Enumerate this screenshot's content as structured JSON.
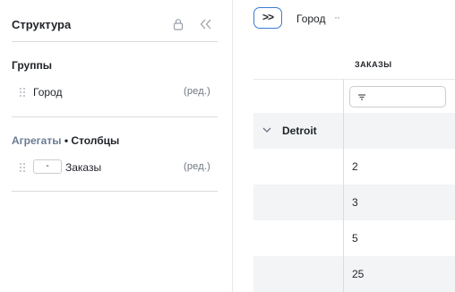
{
  "sidebar": {
    "title": "Структура",
    "groups_section": {
      "title": "Группы",
      "items": [
        {
          "label": "Город",
          "edit_label": "(ред.)"
        }
      ]
    },
    "aggregates_section": {
      "title_part1": "Агрегаты",
      "separator": "•",
      "title_part2": "Столбцы",
      "items": [
        {
          "agg": "-",
          "label": "Заказы",
          "edit_label": "(ред.)"
        }
      ]
    }
  },
  "toolbar": {
    "expand_label": ">>",
    "breadcrumb": "Город",
    "breadcrumb_more": "··"
  },
  "grid": {
    "column_header": "ЗАКАЗЫ",
    "group": {
      "label": "Detroit"
    },
    "rows": [
      "2",
      "3",
      "5",
      "25"
    ]
  },
  "colors": {
    "accent": "#3a7bd5",
    "row_alt": "#f3f4f6",
    "muted_heading": "#6b7c93"
  }
}
